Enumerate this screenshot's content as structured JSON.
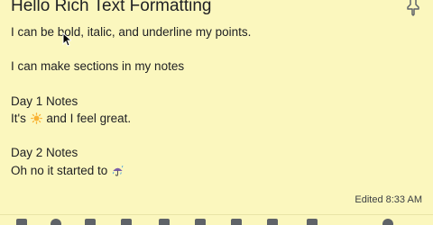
{
  "note": {
    "title": "Hello Rich Text Formatting",
    "lines": [
      "I can be bold, italic, and underline my points.",
      "",
      "I can make sections in my notes",
      "",
      "Day 1 Notes",
      "It's",
      " and I feel great.",
      "",
      "Day 2 Notes",
      "Oh no it started to"
    ],
    "edited": "Edited 8:33 AM"
  },
  "icons": {
    "pin": "pin-icon",
    "sun": "sun-emoji-icon",
    "umbrella": "umbrella-rain-emoji-icon",
    "cursor": "mouse-cursor-icon"
  },
  "colors": {
    "background": "#fbf7be"
  }
}
